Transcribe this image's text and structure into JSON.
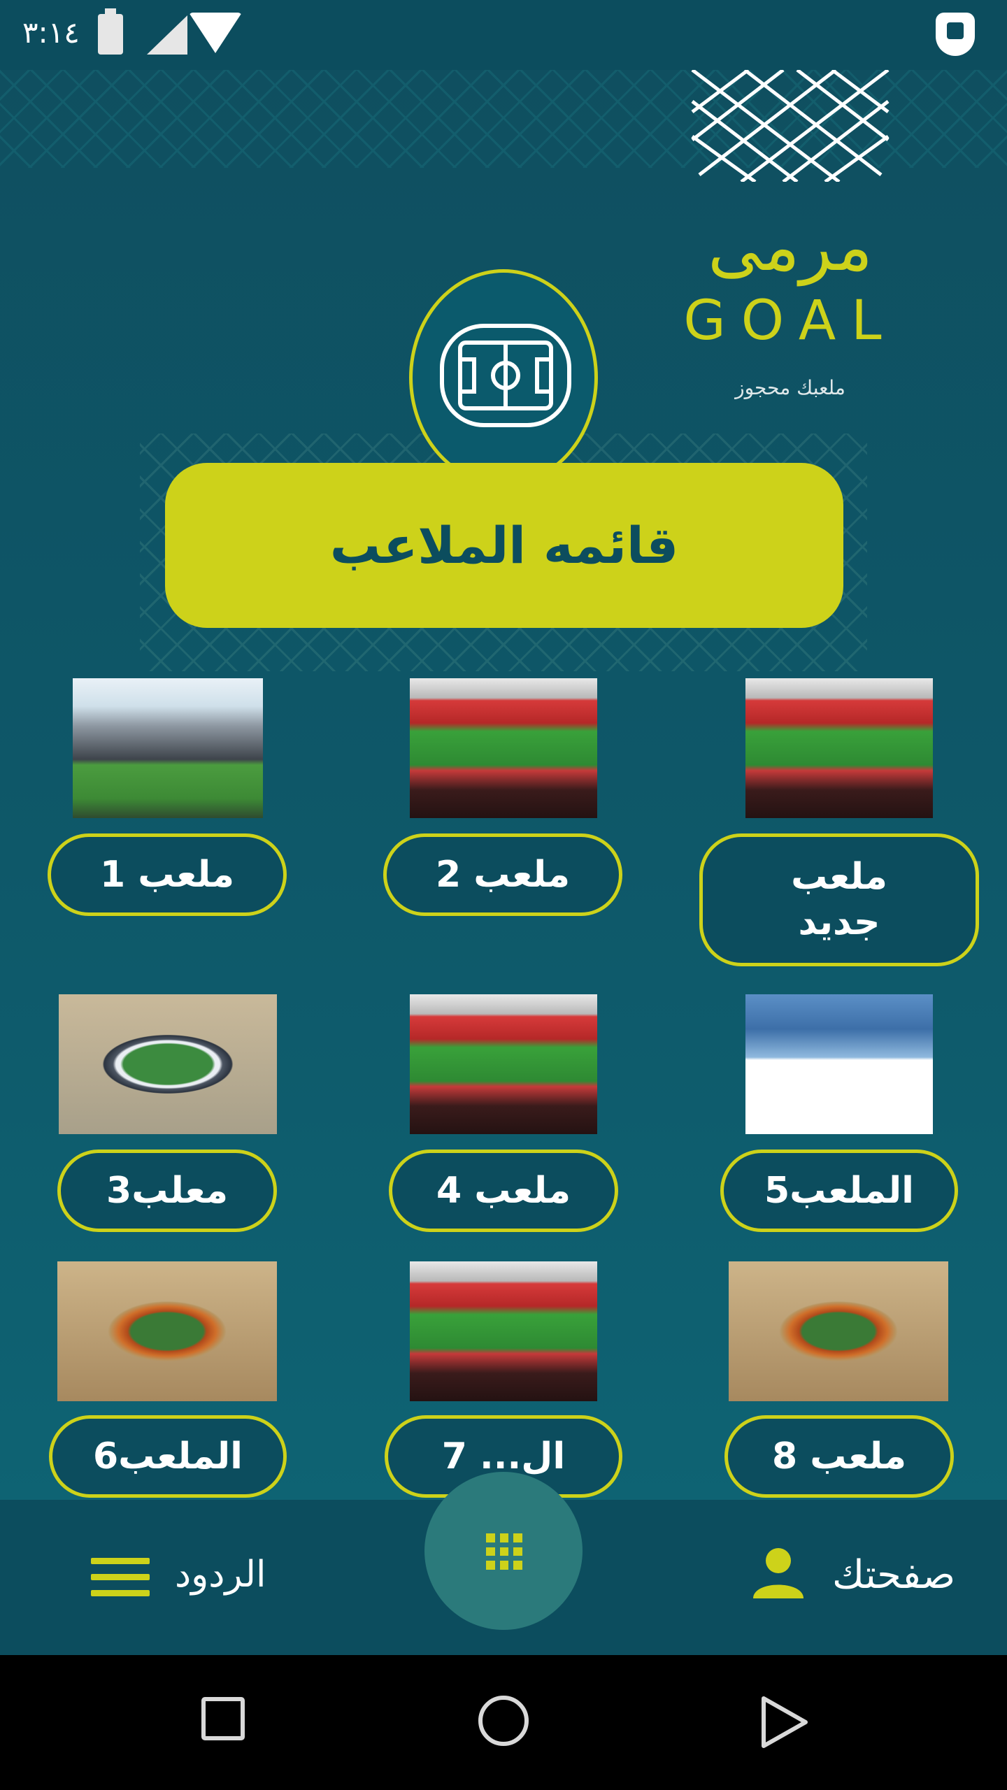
{
  "status_bar": {
    "time": "٣:١٤"
  },
  "logo": {
    "arabic": "مرمى",
    "latin": "GOAL",
    "tagline": "ملعبك محجوز"
  },
  "banner": {
    "title": "قائمه الملاعب"
  },
  "stadiums": [
    {
      "label": "ملعب 1"
    },
    {
      "label": "ملعب 2"
    },
    {
      "label": "ملعب جديد"
    },
    {
      "label": "معلب3"
    },
    {
      "label": "ملعب 4"
    },
    {
      "label": "الملعب5"
    },
    {
      "label": "الملعب6"
    },
    {
      "label": "ال... 7"
    },
    {
      "label": "ملعب 8"
    }
  ],
  "bottom_nav": {
    "profile_label": "صفحتك",
    "replies_label": "الردود"
  },
  "colors": {
    "accent": "#cdd21a",
    "primary_dark": "#0c4d5e",
    "background": "#0e5a6b",
    "fab": "#2b7a7b"
  },
  "icons": [
    "battery-charging-icon",
    "cell-signal-icon",
    "wifi-icon",
    "shield-icon",
    "football-field-icon",
    "grid-icon",
    "person-icon",
    "menu-icon",
    "recents-square-icon",
    "home-circle-icon",
    "back-triangle-icon"
  ]
}
